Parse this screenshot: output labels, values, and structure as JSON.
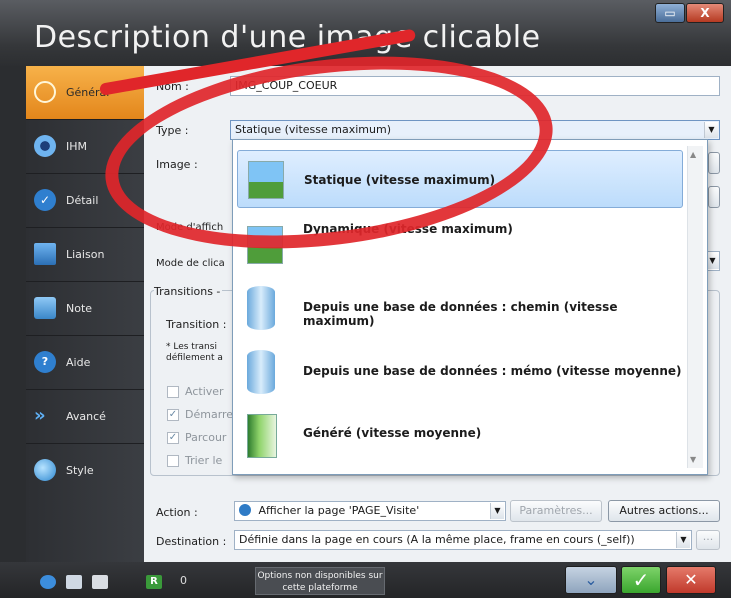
{
  "window": {
    "title": "Description d'une image clicable",
    "minimize_label": "▭",
    "close_label": "X"
  },
  "sidebar": {
    "items": [
      {
        "label": "Général",
        "icon": "circle-icon",
        "active": true
      },
      {
        "label": "IHM",
        "icon": "eye-icon"
      },
      {
        "label": "Détail",
        "icon": "chevron-down-circle-icon"
      },
      {
        "label": "Liaison",
        "icon": "link-icon"
      },
      {
        "label": "Note",
        "icon": "note-pencil-icon"
      },
      {
        "label": "Aide",
        "icon": "help-icon"
      },
      {
        "label": "Avancé",
        "icon": "advanced-arrows-icon"
      },
      {
        "label": "Style",
        "icon": "style-icon"
      }
    ]
  },
  "form": {
    "name_label": "Nom :",
    "name_value": "IMG_COUP_COEUR",
    "type_label": "Type :",
    "type_value": "Statique (vitesse maximum)",
    "image_label": "Image :",
    "mode_affichage_label": "Mode d'affich",
    "mode_clic_label": "Mode de clica",
    "transitions_label": "Transitions -",
    "transition_label": "Transition :",
    "note_label_1": "* Les transi",
    "note_label_2": "défilement a",
    "cb_activer": "Activer",
    "cb_demarrer": "Démarre",
    "cb_parcourir": "Parcour",
    "cb_trier": "Trier le",
    "action_label": "Action :",
    "action_value": "Afficher la page 'PAGE_Visite'",
    "params_button": "Paramètres...",
    "autres_button": "Autres actions...",
    "destination_label": "Destination :",
    "destination_value": "Définie dans la page en cours (A la même place, frame en cours (_self))",
    "ellipsis_button": "···"
  },
  "dropdown": {
    "options": [
      {
        "label": "Statique (vitesse maximum)",
        "icon": "static-image-icon",
        "selected": true
      },
      {
        "label": "Dynamique (vitesse maximum)",
        "icon": "dynamic-image-icon"
      },
      {
        "label": "Depuis une base de données : chemin (vitesse maximum)",
        "icon": "database-path-icon"
      },
      {
        "label": "Depuis une base de données : mémo (vitesse moyenne)",
        "icon": "database-memo-icon"
      },
      {
        "label": "Généré (vitesse moyenne)",
        "icon": "generated-image-icon"
      }
    ]
  },
  "statusbar": {
    "count": "0",
    "note": "Options non disponibles sur cette plateforme"
  },
  "colors": {
    "accent": "#e3861b",
    "annotation": "#e0262a",
    "ok": "#3aa62e",
    "cancel": "#c0392b"
  }
}
